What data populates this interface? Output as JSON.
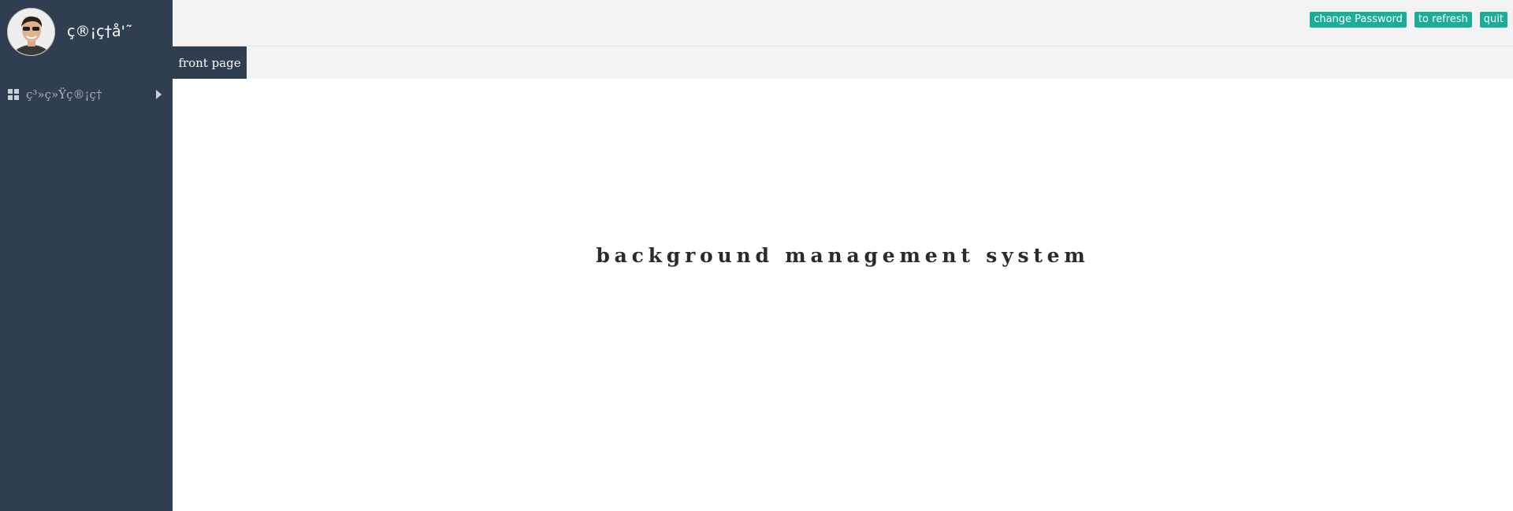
{
  "sidebar": {
    "username": "ç®¡ç†å'˜",
    "avatar_icon": "user-avatar-icon",
    "menu": [
      {
        "label": "ç³»ç»Ÿç®¡ç†",
        "icon": "grid-icon",
        "expand_icon": "caret-right-icon"
      }
    ]
  },
  "header": {
    "buttons": {
      "change_password": "change Password",
      "refresh": "to refresh",
      "quit": "quit"
    }
  },
  "tabs": [
    {
      "label": "front page",
      "active": true
    }
  ],
  "main": {
    "headline": "background management system"
  },
  "colors": {
    "sidebar_bg": "#2f3f4f",
    "button_bg": "#1aad9a",
    "topbar_bg": "#f3f3f3"
  }
}
